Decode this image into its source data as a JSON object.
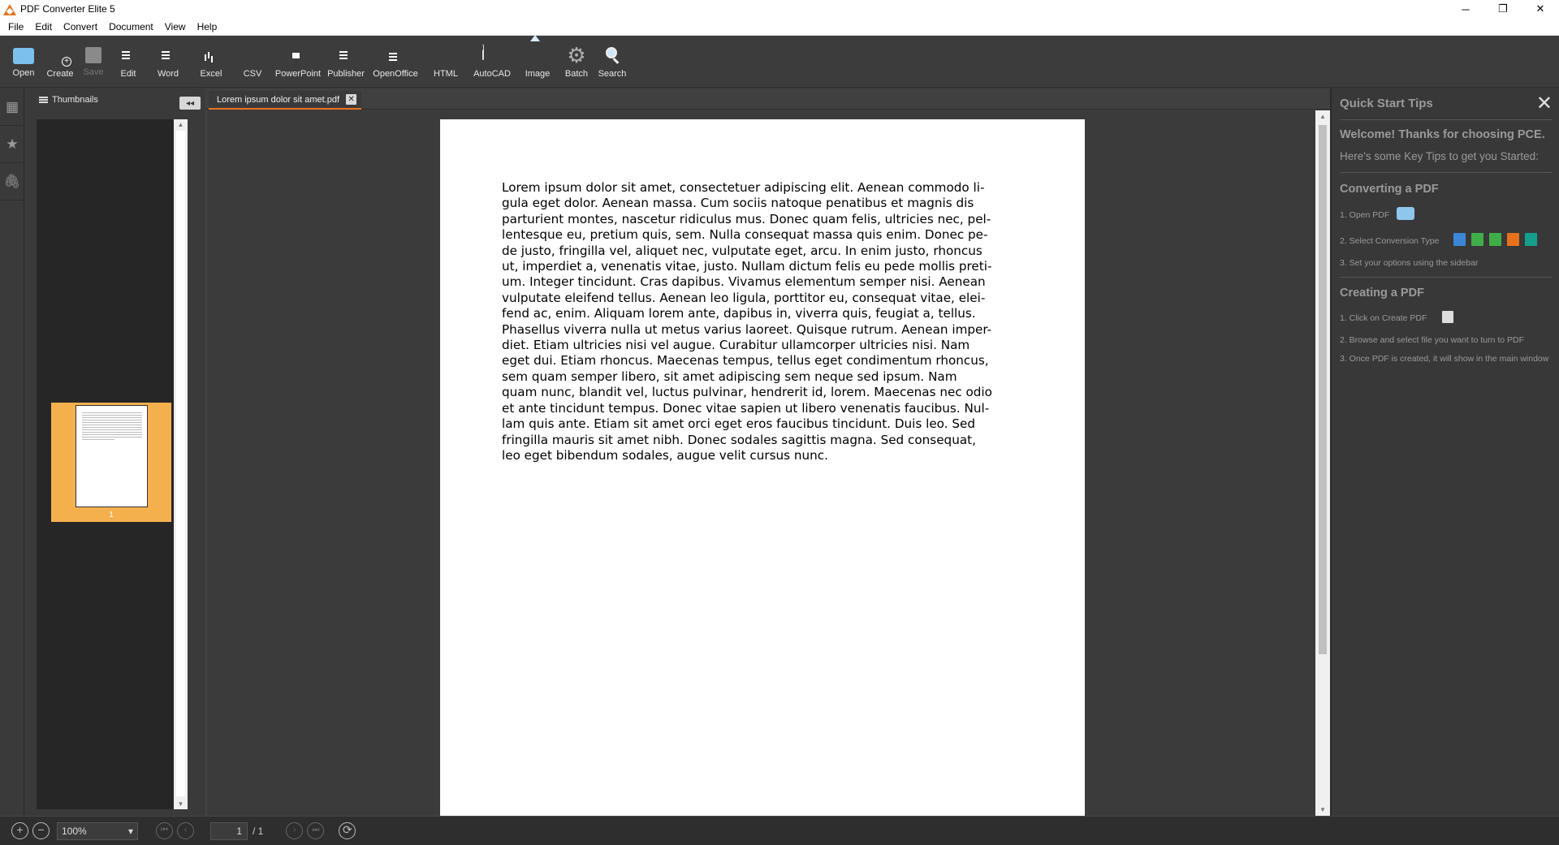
{
  "window": {
    "title": "PDF Converter Elite 5",
    "minimize": "─",
    "maximize": "❐",
    "close": "✕"
  },
  "menu": [
    "File",
    "Edit",
    "Convert",
    "Document",
    "View",
    "Help"
  ],
  "toolbar": [
    {
      "label": "Open",
      "icon": "folder-icon",
      "color": "#4ea5e6"
    },
    {
      "label": "Create",
      "icon": "create-pdf-icon",
      "color": "#d9d9d9"
    },
    {
      "label": "Save",
      "icon": "save-icon",
      "color": "#8a8a8a",
      "disabled": true
    },
    {
      "label": "Edit",
      "icon": "edit-icon",
      "color": "#e87f2c"
    },
    {
      "label": "Word",
      "icon": "word-icon",
      "color": "#3b86d6"
    },
    {
      "label": "Excel",
      "icon": "excel-icon",
      "color": "#3fae49"
    },
    {
      "label": "CSV",
      "icon": "csv-icon",
      "color": "#3fae49"
    },
    {
      "label": "PowerPoint",
      "icon": "powerpoint-icon",
      "color": "#e8721c"
    },
    {
      "label": "Publisher",
      "icon": "publisher-icon",
      "color": "#149f8c"
    },
    {
      "label": "OpenOffice",
      "icon": "openoffice-icon",
      "color": "#3a6fb5"
    },
    {
      "label": "HTML",
      "icon": "html-icon",
      "color": "#3b8ee6"
    },
    {
      "label": "AutoCAD",
      "icon": "autocad-icon",
      "color": "#d9d9d9"
    },
    {
      "label": "Image",
      "icon": "image-icon",
      "color": "#4a90d6"
    },
    {
      "label": "Batch",
      "icon": "gear-icon",
      "color": "#9a9a9a"
    },
    {
      "label": "Search",
      "icon": "search-icon",
      "color": "#6aa9e0"
    }
  ],
  "sidebar": {
    "title": "Thumbnails",
    "collapse": "◂◂",
    "page_label": "1"
  },
  "document": {
    "tab_label": "Lorem ipsum dolor sit amet.pdf",
    "tab_close": "✕",
    "body": "Lorem ipsum dolor sit amet, consectetuer adipiscing elit. Aenean commodo li-\ngula eget dolor. Aenean massa. Cum sociis natoque penatibus et magnis dis\nparturient montes, nascetur ridiculus mus. Donec quam felis, ultricies nec, pel-\nlentesque eu, pretium quis, sem. Nulla consequat massa quis enim. Donec pe-\nde justo, fringilla vel, aliquet nec, vulputate eget, arcu. In enim justo, rhoncus\nut, imperdiet a, venenatis vitae, justo. Nullam dictum felis eu pede mollis preti-\num. Integer tincidunt. Cras dapibus. Vivamus elementum semper nisi. Aenean\nvulputate eleifend tellus. Aenean leo ligula, porttitor eu, consequat vitae, elei-\nfend ac, enim. Aliquam lorem ante, dapibus in, viverra quis, feugiat a, tellus.\nPhasellus viverra nulla ut metus varius laoreet. Quisque rutrum. Aenean imper-\ndiet. Etiam ultricies nisi vel augue. Curabitur ullamcorper ultricies nisi. Nam\neget dui. Etiam rhoncus. Maecenas tempus, tellus eget condimentum rhoncus,\nsem quam semper libero, sit amet adipiscing sem neque sed ipsum. Nam\nquam nunc, blandit vel, luctus pulvinar, hendrerit id, lorem. Maecenas nec odio\net ante tincidunt tempus. Donec vitae sapien ut libero venenatis faucibus. Nul-\nlam quis ante. Etiam sit amet orci eget eros faucibus tincidunt. Duis leo. Sed\nfringilla mauris sit amet nibh. Donec sodales sagittis magna. Sed consequat,\nleo eget bibendum sodales, augue velit cursus nunc."
  },
  "tips": {
    "title": "Quick Start Tips",
    "close": "✕",
    "welcome": "Welcome! Thanks for choosing PCE.",
    "subtitle": "Here's some Key Tips to get you Started:",
    "converting_heading": "Converting a PDF",
    "converting_steps": [
      "1. Open PDF",
      "2. Select Conversion Type",
      "3. Set your options using the sidebar"
    ],
    "creating_heading": "Creating a PDF",
    "creating_steps": [
      "1. Click on Create PDF",
      "2. Browse and select file you want to turn to PDF",
      "3. Once PDF is created, it will show in the main window"
    ]
  },
  "status": {
    "zoom": "100%",
    "zoom_arrow": "▾",
    "page_current": "1",
    "page_total": "/ 1",
    "zoom_in": "+",
    "zoom_out": "−",
    "first": "⏮",
    "prev": "‹",
    "next": "›",
    "last": "⏭",
    "rotate": "⟳"
  },
  "colors": {
    "accent": "#e8721c",
    "thumb_highlight": "#f5b04e"
  }
}
